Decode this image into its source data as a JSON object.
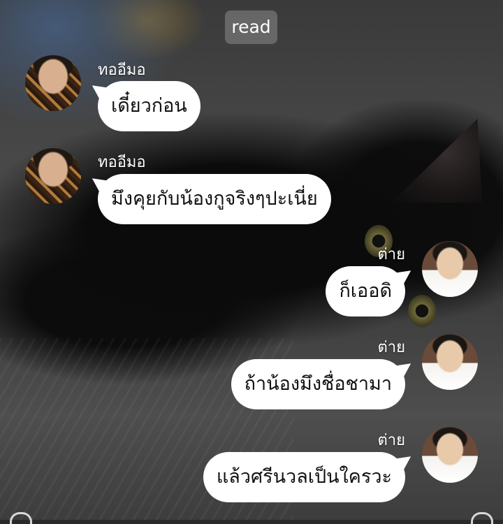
{
  "status": {
    "read_label": "read"
  },
  "messages": [
    {
      "side": "left",
      "sender": "ทออีมอ",
      "text": "เดี๋ยวก่อน"
    },
    {
      "side": "left",
      "sender": "ทออีมอ",
      "text": "มึงคุยกับน้องกูจริงๆปะเนี่ย"
    },
    {
      "side": "right",
      "sender": "ต่าย",
      "text": "ก็เออดิ"
    },
    {
      "side": "right",
      "sender": "ต่าย",
      "text": "ถ้าน้องมึงชื่อชามา"
    },
    {
      "side": "right",
      "sender": "ต่าย",
      "text": "แล้วศรีนวลเป็นใครวะ"
    }
  ],
  "colors": {
    "bubble": "#ffffff",
    "badge": "#6e6e6e",
    "text": "#111111"
  }
}
